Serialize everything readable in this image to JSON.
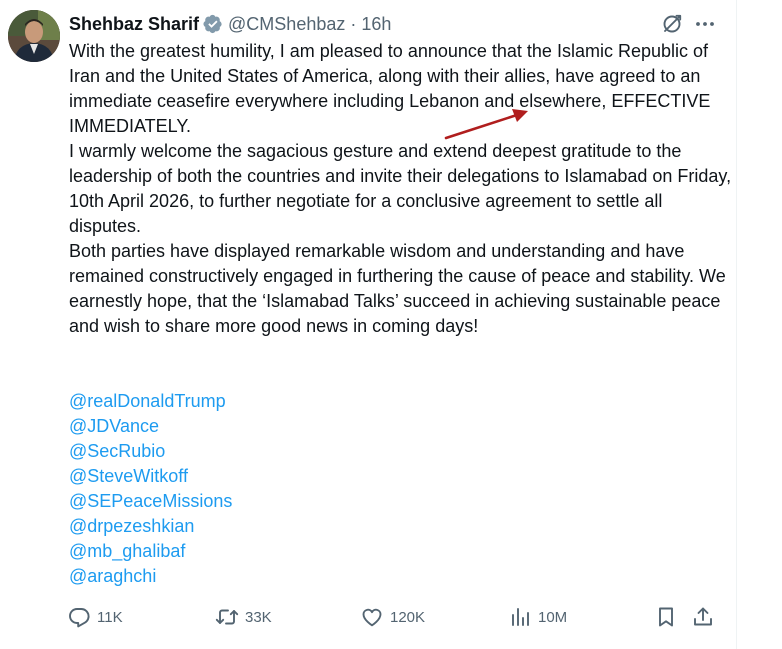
{
  "author": {
    "name": "Shehbaz Sharif",
    "handle": "@CMShehbaz",
    "separator": "·",
    "time": "16h",
    "verified": true
  },
  "body": {
    "paragraphs": [
      "With the greatest humility, I am pleased to announce that the Islamic Republic of Iran and the United States of America, along with their allies, have agreed to an immediate ceasefire everywhere including Lebanon and elsewhere, EFFECTIVE IMMEDIATELY.",
      "I warmly welcome the sagacious gesture and extend deepest gratitude to the leadership of both the countries and invite their delegations to Islamabad on Friday, 10th April 2026, to further negotiate for a conclusive agreement to settle all disputes.",
      "Both parties have displayed remarkable wisdom and understanding and have remained constructively engaged in furthering the cause of peace and stability. We earnestly hope, that the ‘Islamabad Talks’ succeed in achieving sustainable peace and wish to share more good news in coming days!"
    ]
  },
  "mentions": [
    "@realDonaldTrump",
    "@JDVance",
    "@SecRubio",
    "@SteveWitkoff",
    "@SEPeaceMissions",
    "@drpezeshkian",
    "@mb_ghalibaf",
    "@araghchi"
  ],
  "actions": {
    "replies": "11K",
    "reposts": "33K",
    "likes": "120K",
    "views": "10M"
  },
  "icons": {
    "verified": "verified-badge-icon",
    "grok": "grok-icon",
    "more": "more-icon",
    "reply": "reply-icon",
    "repost": "repost-icon",
    "like": "heart-icon",
    "views": "views-icon",
    "bookmark": "bookmark-icon",
    "share": "share-icon"
  },
  "colors": {
    "text": "#0f1419",
    "secondary": "#536471",
    "link": "#1d9bf0",
    "verified": "#829aab",
    "annotation_arrow": "#b01e1e"
  }
}
